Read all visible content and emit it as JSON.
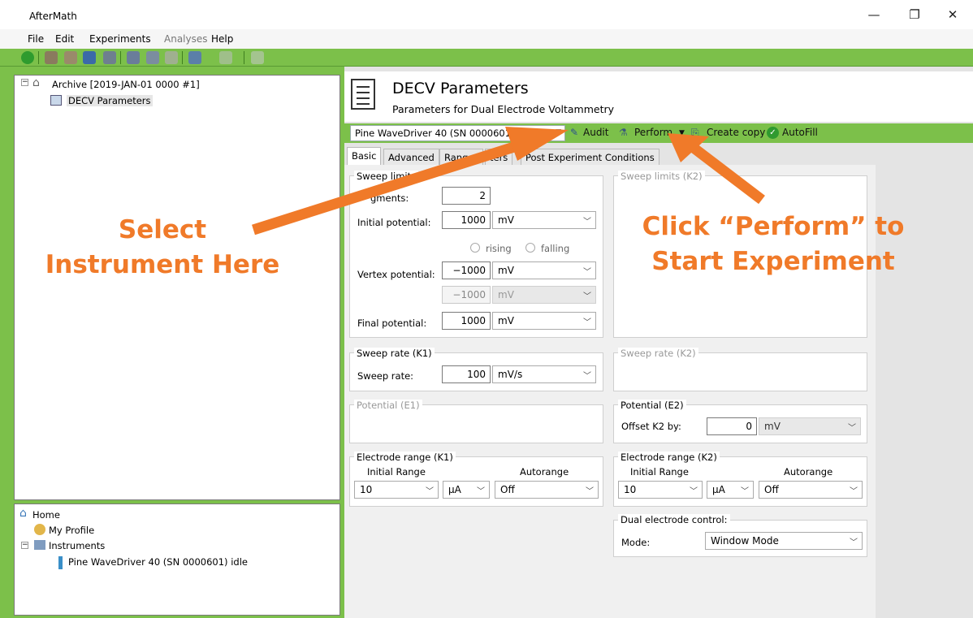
{
  "app_title": "AfterMath",
  "window_controls": {
    "minimize": "—",
    "restore": "❐",
    "close": "✕"
  },
  "menu": [
    "File",
    "Edit",
    "Experiments",
    "Analyses",
    "Help"
  ],
  "tree_top": {
    "archive": "Archive [2019-JAN-01 0000 #1]",
    "child": "DECV Parameters"
  },
  "tree_bottom": {
    "home": "Home",
    "profile": "My Profile",
    "instruments": "Instruments",
    "instrument": "Pine WaveDriver 40 (SN 0000601) idle"
  },
  "header": {
    "title": "DECV Parameters",
    "subtitle": "Parameters for Dual Electrode Voltammetry"
  },
  "instrument_select": "Pine WaveDriver 40 (SN 0000601)",
  "toolbar_buttons": {
    "audit": "Audit",
    "perform": "Perform",
    "create_copy": "Create copy",
    "autofill": "AutoFill"
  },
  "tabs": [
    "Basic",
    "Advanced",
    "Ranges",
    "ters",
    "Post Experiment Conditions"
  ],
  "sweep_limits_k1": {
    "title": "Sweep limits",
    "segments_label": "gments:",
    "segments": "2",
    "initial_label": "Initial potential:",
    "initial": "1000",
    "initial_unit": "mV",
    "rising": "rising",
    "falling": "falling",
    "vertex_label": "Vertex potential:",
    "vertex": "−1000",
    "vertex_unit": "mV",
    "vertex2": "−1000",
    "vertex2_unit": "mV",
    "final_label": "Final potential:",
    "final": "1000",
    "final_unit": "mV"
  },
  "sweep_limits_k2": {
    "title": "Sweep limits (K2)"
  },
  "sweep_rate_k1": {
    "title": "Sweep rate (K1)",
    "label": "Sweep rate:",
    "value": "100",
    "unit": "mV/s"
  },
  "sweep_rate_k2": {
    "title": "Sweep rate (K2)"
  },
  "potential_e1": {
    "title": "Potential (E1)"
  },
  "potential_e2": {
    "title": "Potential (E2)",
    "label": "Offset K2 by:",
    "value": "0",
    "unit": "mV"
  },
  "range_k1": {
    "title": "Electrode range (K1)",
    "initial_label": "Initial Range",
    "autorange_label": "Autorange",
    "value": "10",
    "unit": "µA",
    "autorange": "Off"
  },
  "range_k2": {
    "title": "Electrode range (K2)",
    "initial_label": "Initial Range",
    "autorange_label": "Autorange",
    "value": "10",
    "unit": "µA",
    "autorange": "Off"
  },
  "dual_control": {
    "title": "Dual electrode control:",
    "mode_label": "Mode:",
    "mode": "Window Mode"
  },
  "annotations": {
    "left_line1": "Select",
    "left_line2": "Instrument Here",
    "right_line1": "Click “Perform” to",
    "right_line2": "Start Experiment",
    "color": "#f07a29"
  }
}
